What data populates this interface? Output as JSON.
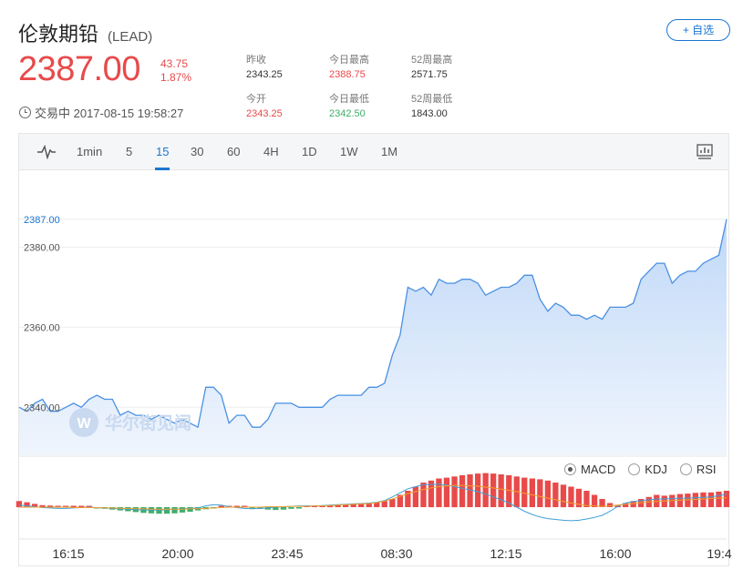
{
  "header": {
    "title": "伦敦期铅",
    "code": "(LEAD)",
    "add_label": "+ 自选"
  },
  "quote": {
    "price": "2387.00",
    "change": "43.75",
    "change_pct": "1.87%",
    "trade_status": "交易中 2017-08-15 19:58:27"
  },
  "stats": {
    "prev_close_label": "昨收",
    "prev_close": "2343.25",
    "open_label": "今开",
    "open": "2343.25",
    "high_label": "今日最高",
    "high": "2388.75",
    "low_label": "今日最低",
    "low": "2342.50",
    "w52_high_label": "52周最高",
    "w52_high": "2571.75",
    "w52_low_label": "52周最低",
    "w52_low": "1843.00"
  },
  "toolbar": {
    "intervals": [
      "1min",
      "5",
      "15",
      "30",
      "60",
      "4H",
      "1D",
      "1W",
      "1M"
    ],
    "active": "15"
  },
  "indicators": {
    "macd": "MACD",
    "kdj": "KDJ",
    "rsi": "RSI",
    "selected": "MACD"
  },
  "watermark": "华尔街见闻",
  "colors": {
    "up": "#e84a4a",
    "down": "#3fae6a",
    "accent": "#1976d2",
    "line": "#4a90e2"
  },
  "chart_data": {
    "type": "area",
    "current_label": "2387.00",
    "y_ticks": [
      "2380.00",
      "2360.00",
      "2340.00"
    ],
    "x_ticks": [
      "16:15",
      "20:00",
      "23:45",
      "08:30",
      "12:15",
      "16:00",
      "19:4"
    ],
    "ylim": [
      2328,
      2394
    ],
    "values": [
      2340,
      2339,
      2341,
      2342,
      2339,
      2339,
      2340,
      2341,
      2340,
      2342,
      2343,
      2342,
      2342,
      2338,
      2339,
      2338,
      2338,
      2337,
      2338,
      2337,
      2336,
      2337,
      2336,
      2335,
      2345,
      2345,
      2343,
      2336,
      2338,
      2338,
      2335,
      2335,
      2337,
      2341,
      2341,
      2341,
      2340,
      2340,
      2340,
      2340,
      2342,
      2343,
      2343,
      2343,
      2343,
      2345,
      2345,
      2346,
      2353,
      2358,
      2370,
      2369,
      2370,
      2368,
      2372,
      2371,
      2371,
      2372,
      2372,
      2371,
      2368,
      2369,
      2370,
      2370,
      2371,
      2373,
      2373,
      2367,
      2364,
      2366,
      2365,
      2363,
      2363,
      2362,
      2363,
      2362,
      2365,
      2365,
      2365,
      2366,
      2372,
      2374,
      2376,
      2376,
      2371,
      2373,
      2374,
      2374,
      2376,
      2377,
      2378,
      2387
    ],
    "macd_bars": [
      1.5,
      1.2,
      0.8,
      0.5,
      0.4,
      0.3,
      0.2,
      0.2,
      0.1,
      0.1,
      -0.2,
      -0.4,
      -0.6,
      -0.8,
      -1,
      -1.2,
      -1.4,
      -1.5,
      -1.6,
      -1.6,
      -1.5,
      -1.3,
      -1.1,
      -0.8,
      -0.5,
      -0.3,
      0.1,
      0.3,
      0.2,
      0,
      -0.2,
      -0.4,
      -0.6,
      -0.7,
      -0.6,
      -0.4,
      -0.2,
      0,
      0.2,
      0.4,
      0.5,
      0.6,
      0.6,
      0.7,
      0.8,
      1,
      1.2,
      1.5,
      2,
      3,
      4,
      5,
      6,
      6.5,
      7,
      7.2,
      7.5,
      7.8,
      8,
      8.2,
      8.3,
      8.2,
      8,
      7.8,
      7.5,
      7.2,
      7,
      6.8,
      6.5,
      6,
      5.5,
      5,
      4.5,
      4,
      3,
      2,
      1,
      0.5,
      1,
      1.5,
      2,
      2.5,
      3,
      2.8,
      3,
      3.2,
      3.3,
      3.5,
      3.6,
      3.6,
      3.8,
      4
    ],
    "dif": [
      0.5,
      0.3,
      0.1,
      -0.1,
      -0.2,
      -0.3,
      -0.3,
      -0.2,
      -0.1,
      0,
      -0.1,
      -0.2,
      -0.3,
      -0.4,
      -0.5,
      -0.6,
      -0.7,
      -0.7,
      -0.7,
      -0.6,
      -0.5,
      -0.4,
      -0.3,
      -0.2,
      0.3,
      0.6,
      0.5,
      0.1,
      -0.1,
      -0.3,
      -0.4,
      -0.3,
      -0.2,
      0,
      0.1,
      0.2,
      0.3,
      0.3,
      0.3,
      0.4,
      0.5,
      0.6,
      0.7,
      0.8,
      0.9,
      1,
      1.2,
      1.6,
      2.5,
      3.5,
      4.5,
      5,
      5.5,
      5.5,
      5.6,
      5.4,
      5,
      4.6,
      4.2,
      3.8,
      3.2,
      2.5,
      1.8,
      1,
      0,
      -1,
      -1.8,
      -2.4,
      -2.8,
      -3,
      -3.2,
      -3.3,
      -3.2,
      -2.9,
      -2.5,
      -2,
      -1,
      0.2,
      1,
      1.4,
      1.6,
      1.8,
      2,
      2,
      2.1,
      2.2,
      2.2,
      2.3,
      2.4,
      2.5,
      2.8,
      3.2
    ],
    "dea": [
      0,
      0,
      0,
      0,
      0,
      0,
      0,
      -0.1,
      -0.1,
      -0.1,
      -0.1,
      -0.2,
      -0.2,
      -0.3,
      -0.3,
      -0.4,
      -0.4,
      -0.5,
      -0.5,
      -0.5,
      -0.5,
      -0.5,
      -0.4,
      -0.4,
      -0.3,
      -0.2,
      -0.1,
      0,
      0,
      0,
      0,
      0,
      0.1,
      0.1,
      0.1,
      0.2,
      0.2,
      0.2,
      0.3,
      0.3,
      0.4,
      0.5,
      0.6,
      0.7,
      0.8,
      0.9,
      1.1,
      1.5,
      2,
      2.6,
      3.3,
      3.8,
      4.3,
      4.7,
      5,
      5.2,
      5.3,
      5.3,
      5.2,
      5.1,
      4.9,
      4.7,
      4.4,
      4.1,
      3.8,
      3.4,
      3,
      2.6,
      2.2,
      1.8,
      1.4,
      1,
      0.7,
      0.4,
      0.3,
      0.2,
      0.3,
      0.5,
      0.7,
      0.9,
      1.1,
      1.3,
      1.4,
      1.5,
      1.6,
      1.7,
      1.8,
      1.9,
      2,
      2.1,
      2.2,
      2.3
    ]
  }
}
